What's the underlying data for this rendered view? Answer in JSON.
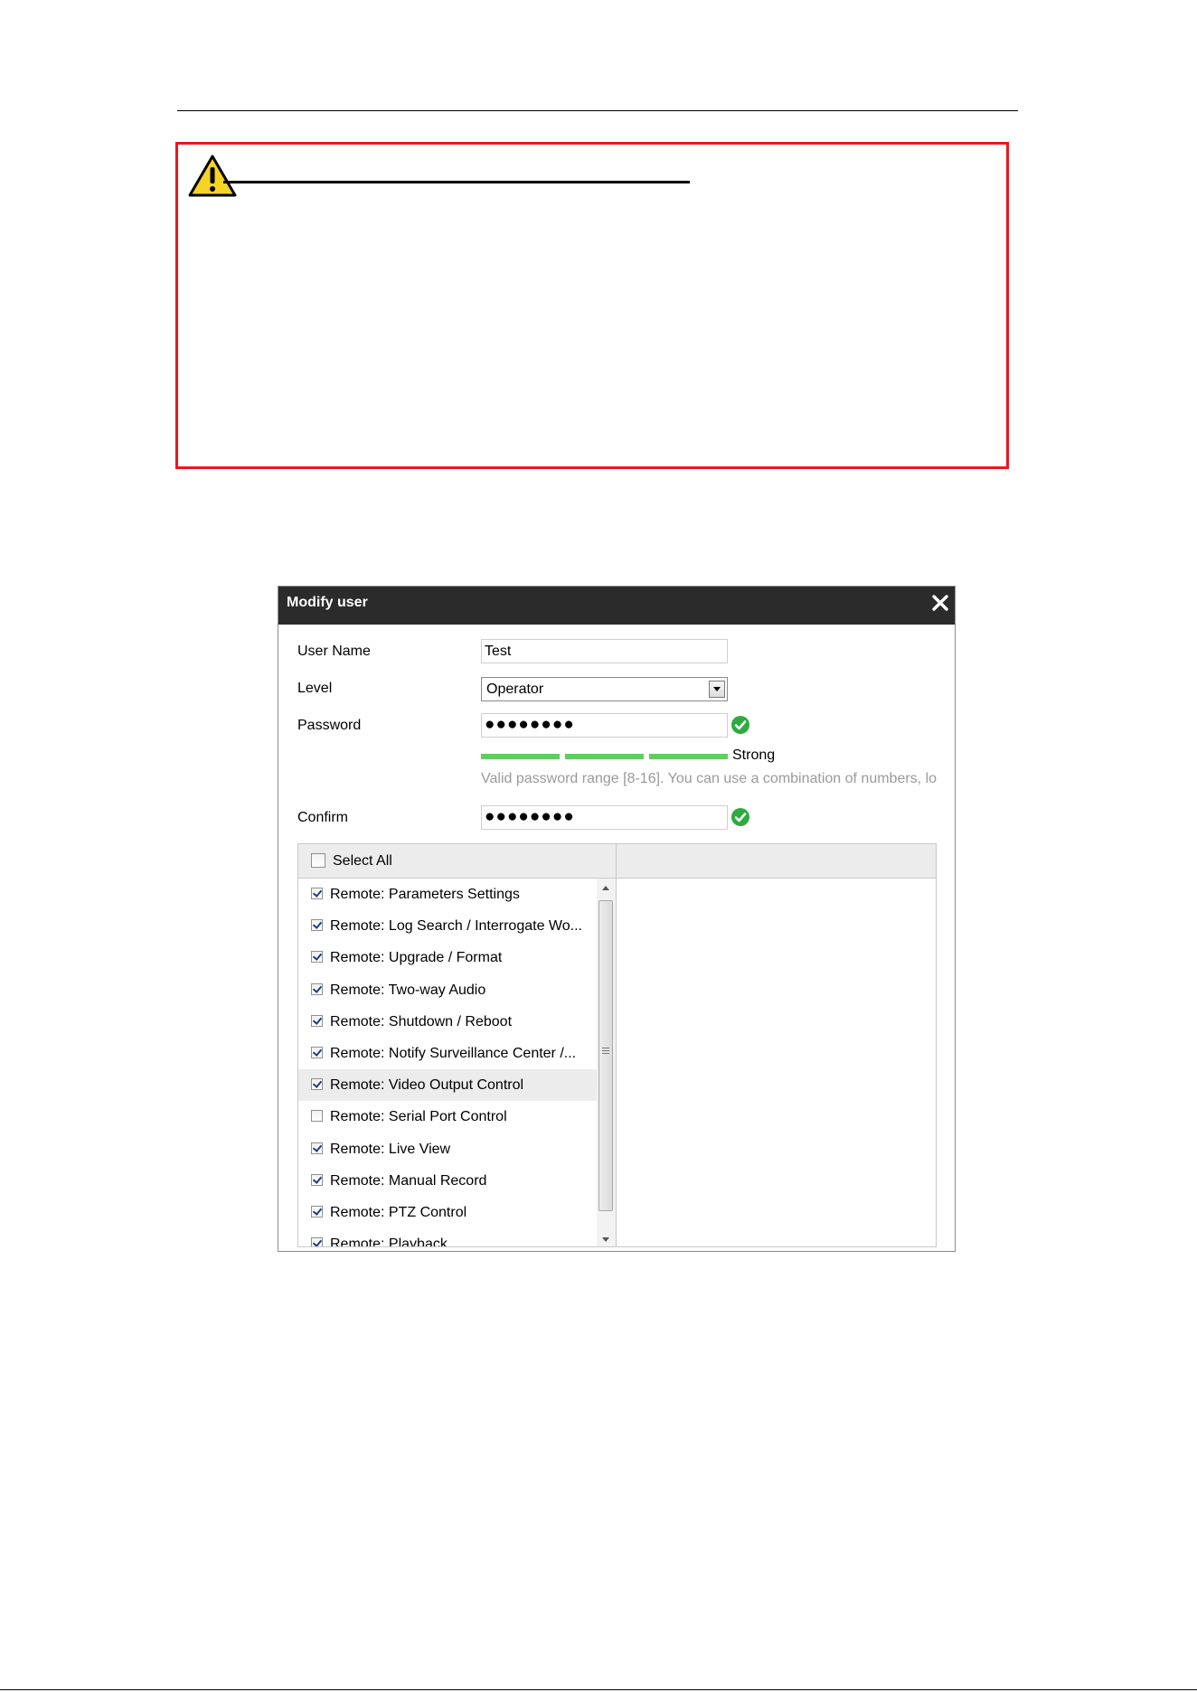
{
  "dialog": {
    "title": "Modify user",
    "user_name": {
      "label": "User Name",
      "value": "Test"
    },
    "level": {
      "label": "Level",
      "selected": "Operator"
    },
    "password": {
      "label": "Password",
      "value": "●●●●●●●●",
      "status_icon": "check-circle-icon"
    },
    "strength": {
      "text": "Strong",
      "level": 1.0,
      "color": "#5fce5f"
    },
    "password_hint": "Valid password range [8-16]. You can use a combination of numbers, lo",
    "confirm": {
      "label": "Confirm",
      "value": "●●●●●●●●",
      "status_icon": "check-circle-icon"
    },
    "permissions": {
      "select_all": {
        "label": "Select All",
        "checked": false
      },
      "items": [
        {
          "label": "Remote: Parameters Settings",
          "checked": true
        },
        {
          "label": "Remote: Log Search / Interrogate Wo...",
          "checked": true
        },
        {
          "label": "Remote: Upgrade / Format",
          "checked": true
        },
        {
          "label": "Remote: Two-way Audio",
          "checked": true
        },
        {
          "label": "Remote: Shutdown / Reboot",
          "checked": true
        },
        {
          "label": "Remote: Notify Surveillance Center /...",
          "checked": true
        },
        {
          "label": "Remote: Video Output Control",
          "checked": true,
          "highlighted": true
        },
        {
          "label": "Remote: Serial Port Control",
          "checked": false
        },
        {
          "label": "Remote: Live View",
          "checked": true
        },
        {
          "label": "Remote: Manual Record",
          "checked": true
        },
        {
          "label": "Remote: PTZ Control",
          "checked": true
        },
        {
          "label": "Remote: Playback",
          "checked": true
        }
      ]
    }
  },
  "colors": {
    "caution_border": "#e8191c",
    "caution_icon": "#f5d327",
    "dialog_header": "#2b2b2b",
    "ok_green": "#2eaa3f",
    "hint_text": "#9a9a9a"
  },
  "icons": {
    "caution": "warning-triangle-icon",
    "close": "close-icon",
    "dropdown": "chevron-down-icon"
  }
}
